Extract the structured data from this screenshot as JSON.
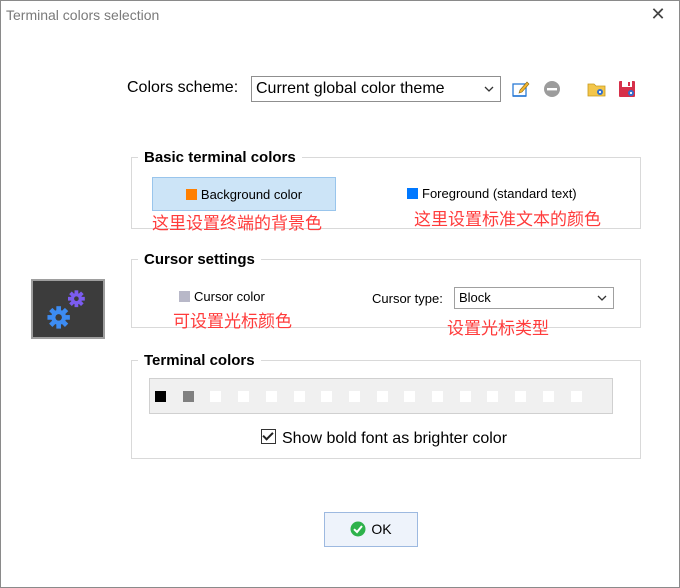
{
  "window": {
    "title": "Terminal colors selection",
    "close_glyph": "✕"
  },
  "scheme": {
    "label": "Colors scheme:",
    "selected": "Current global color theme",
    "buttons": [
      "edit-scheme-icon",
      "remove-scheme-icon",
      "open-folder-icon",
      "save-icon"
    ]
  },
  "basic_colors": {
    "legend": "Basic terminal colors",
    "background_label": "Background color",
    "background_swatch": "#ff7f00",
    "foreground_label": "Foreground (standard text)",
    "foreground_swatch": "#0078ff",
    "note_background": "这里设置终端的背景色",
    "note_foreground": "这里设置标准文本的颜色"
  },
  "cursor": {
    "legend": "Cursor settings",
    "color_label": "Cursor color",
    "color_swatch": "#b8b8c8",
    "type_label": "Cursor type:",
    "type_value": "Block",
    "note_color": "可设置光标颜色",
    "note_type": "设置光标类型"
  },
  "terminal_colors": {
    "legend": "Terminal colors",
    "palette": [
      "#000000",
      "#808080",
      "#ffffff",
      "#ffffff",
      "#ffffff",
      "#ffffff",
      "#ffffff",
      "#ffffff",
      "#ffffff",
      "#ffffff",
      "#ffffff",
      "#ffffff",
      "#ffffff",
      "#ffffff",
      "#ffffff",
      "#ffffff"
    ],
    "bold_checkbox_label": "Show bold font as brighter color",
    "bold_checked": true
  },
  "ok_label": "OK",
  "colors": {
    "accent": "#0078d7",
    "note": "#ff3b3b",
    "ok_green": "#2eb24b"
  }
}
